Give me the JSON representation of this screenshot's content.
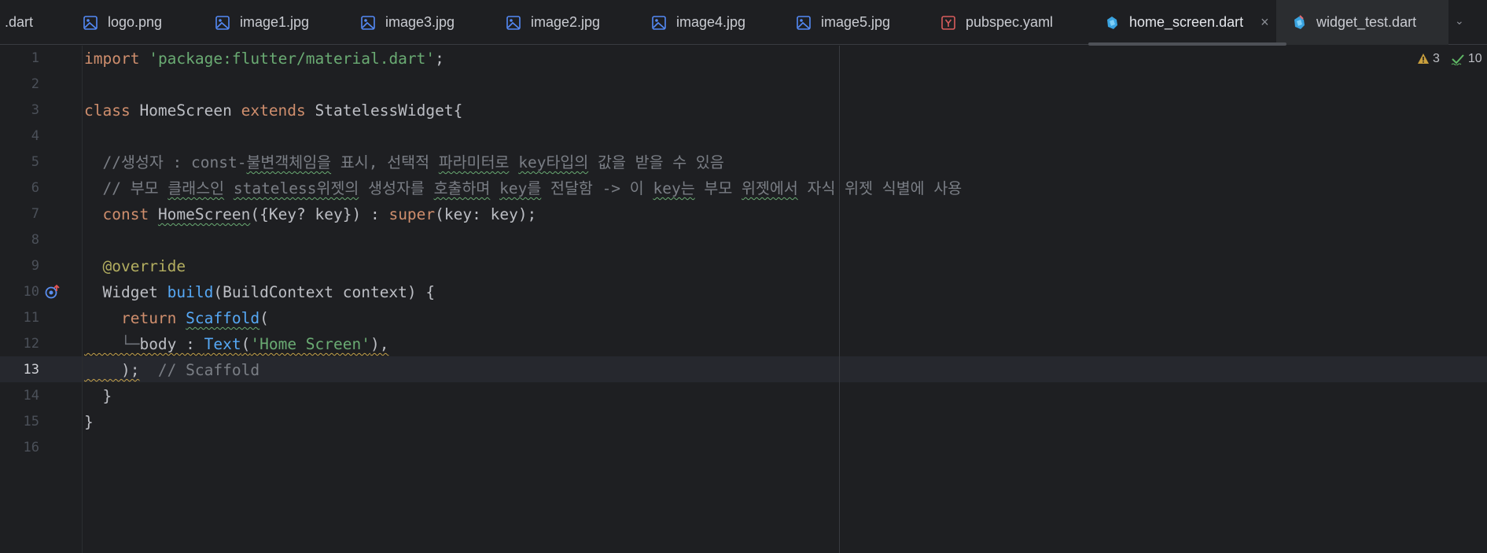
{
  "tabs": [
    {
      "label": ".dart",
      "icon": "dart-file-icon"
    },
    {
      "label": "logo.png",
      "icon": "image-file-icon"
    },
    {
      "label": "image1.jpg",
      "icon": "image-file-icon"
    },
    {
      "label": "image3.jpg",
      "icon": "image-file-icon"
    },
    {
      "label": "image2.jpg",
      "icon": "image-file-icon"
    },
    {
      "label": "image4.jpg",
      "icon": "image-file-icon"
    },
    {
      "label": "image5.jpg",
      "icon": "image-file-icon"
    },
    {
      "label": "pubspec.yaml",
      "icon": "yaml-file-icon"
    },
    {
      "label": "home_screen.dart",
      "icon": "dart-file-icon",
      "active": true,
      "close": "×"
    },
    {
      "label": "widget_test.dart",
      "icon": "dart-test-file-icon"
    }
  ],
  "inspections": {
    "warnings": "3",
    "ok": "10"
  },
  "editor": {
    "line_numbers": [
      "1",
      "2",
      "3",
      "4",
      "5",
      "6",
      "7",
      "8",
      "9",
      "10",
      "11",
      "12",
      "13",
      "14",
      "15",
      "16"
    ],
    "current_line": "13",
    "lines": {
      "l1_kw": "import",
      "l1_str": "'package:flutter/material.dart'",
      "l1_end": ";",
      "l3_kw1": "class",
      "l3_name": " HomeScreen ",
      "l3_kw2": "extends",
      "l3_rest": " StatelessWidget{",
      "l5_a": "  //생성자 : const-",
      "l5_b": "불변객체임을",
      "l5_c": " 표시, 선택적 ",
      "l5_d": "파라미터로",
      "l5_e": " ",
      "l5_f": "key타입의",
      "l5_g": " 값을 받을 수 있음",
      "l6_a": "  // 부모 ",
      "l6_b": "클래스인",
      "l6_c": " ",
      "l6_d": "stateless위젯의",
      "l6_e": " 생성자를 ",
      "l6_f": "호출하며",
      "l6_g": " ",
      "l6_h": "key를",
      "l6_i": " 전달함 -> 이 ",
      "l6_j": "key는",
      "l6_k": " 부모 ",
      "l6_l": "위젯에서",
      "l6_m": " 자식 위젯 식별에 사용",
      "l7_indent": "  ",
      "l7_kw": "const",
      "l7_sp": " ",
      "l7_name": "HomeScreen",
      "l7_mid": "({Key? key}) : ",
      "l7_super": "super",
      "l7_end": "(key: key);",
      "l9_indent": "  ",
      "l9_at": "@",
      "l9_ann": "override",
      "l10_a": "  Widget ",
      "l10_fn": "build",
      "l10_b": "(BuildContext context) {",
      "l11_indent": "    ",
      "l11_kw": "return",
      "l11_sp": " ",
      "l11_cls": "Scaffold",
      "l11_end": "(",
      "l12_guide": "    └─",
      "l12_a": "body : ",
      "l12_cls": "Text",
      "l12_b": "(",
      "l12_str": "'Home Screen'",
      "l12_c": "),",
      "l13_a": "    );",
      "l13_cmt": "  // Scaffold",
      "l14": "  }",
      "l15": "}"
    }
  }
}
